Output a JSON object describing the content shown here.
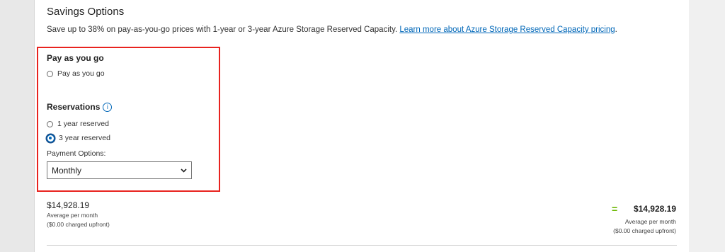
{
  "savings": {
    "title": "Savings Options",
    "description": "Save up to 38% on pay-as-you-go prices with 1-year or 3-year Azure Storage Reserved Capacity. ",
    "learn_more_link": "Learn more about Azure Storage Reserved Capacity pricing",
    "description_end": "."
  },
  "payg": {
    "heading": "Pay as you go",
    "option_label": "Pay as you go",
    "selected": false
  },
  "reservations": {
    "heading": "Reservations",
    "info_icon": "i",
    "options": [
      {
        "label": "1 year reserved",
        "selected": false
      },
      {
        "label": "3 year reserved",
        "selected": true
      }
    ]
  },
  "payment": {
    "label": "Payment Options:",
    "selected_value": "Monthly"
  },
  "summary_left": {
    "price": "$14,928.19",
    "caption": "Average per month",
    "upfront": "($0.00 charged upfront)"
  },
  "summary_right": {
    "equals": "=",
    "price": "$14,928.19",
    "caption": "Average per month",
    "upfront": "($0.00 charged upfront)"
  },
  "colors": {
    "highlight_border": "#e8231f",
    "link": "#0067b8",
    "equals": "#6bb700"
  }
}
